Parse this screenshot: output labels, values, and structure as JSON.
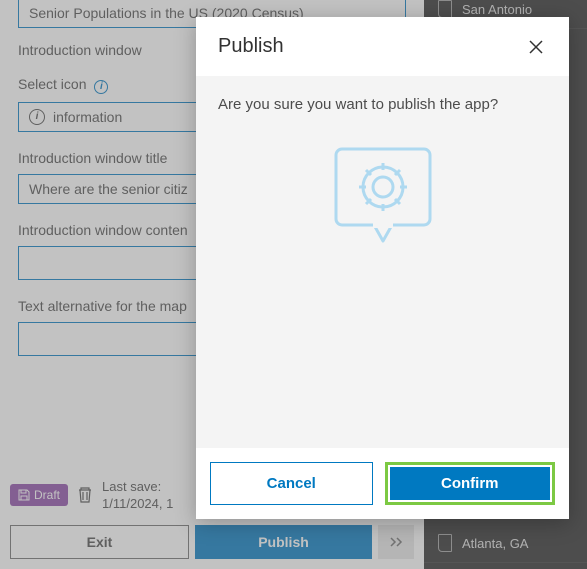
{
  "form": {
    "appTitleValue": "Senior Populations in the US (2020 Census)",
    "introWindowLabel": "Introduction window",
    "selectIconLabel": "Select icon",
    "iconName": "information",
    "introTitleLabel": "Introduction window title",
    "introTitleValue": "Where are the senior citiz",
    "introContentLabel": "Introduction window conten",
    "textAltLabel": "Text alternative for the map"
  },
  "footer": {
    "draftLabel": "Draft",
    "lastSaveLabel": "Last save:",
    "lastSaveTime": "1/11/2024, 1",
    "exitLabel": "Exit",
    "publishLabel": "Publish"
  },
  "rightPanel": {
    "items": [
      "San Antonio",
      "Atlanta, GA"
    ]
  },
  "dialog": {
    "title": "Publish",
    "message": "Are you sure you want to publish the app?",
    "cancelLabel": "Cancel",
    "confirmLabel": "Confirm"
  },
  "colors": {
    "primary": "#0079c1",
    "highlight": "#7cc943",
    "draft": "#8c4ca8",
    "illus": "#aed9f0"
  }
}
